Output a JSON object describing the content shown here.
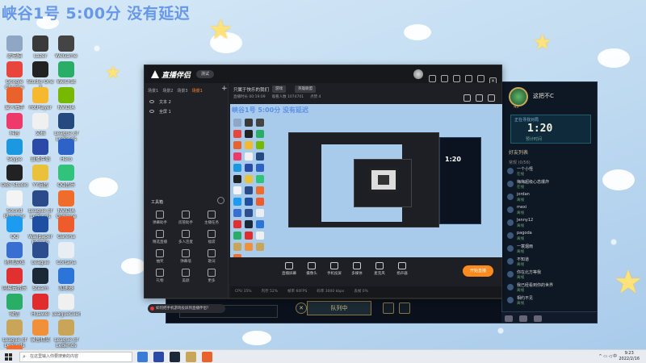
{
  "overlay": {
    "title": "峡谷1号 5:00分 没有延迟"
  },
  "desktop_icons": [
    {
      "label": "此电脑",
      "color": "#8fa6c4",
      "icon": "computer-icon"
    },
    {
      "label": "Lazer",
      "color": "#3a3a3a",
      "icon": "app-icon"
    },
    {
      "label": "WeGame",
      "color": "#444",
      "icon": "wegame-icon"
    },
    {
      "label": "Google Chrome",
      "color": "#e8453c",
      "icon": "chrome-icon"
    },
    {
      "label": "Studio One 3",
      "color": "#222",
      "icon": "studio-one-icon"
    },
    {
      "label": "WeChat",
      "color": "#2aae67",
      "icon": "wechat-icon"
    },
    {
      "label": "爱人抽手",
      "color": "#e9622c",
      "icon": "app-icon"
    },
    {
      "label": "PotPlayer",
      "color": "#f5b82e",
      "icon": "potplayer-icon"
    },
    {
      "label": "NVIDIA",
      "color": "#76b900",
      "icon": "app-icon"
    },
    {
      "label": "抖音",
      "color": "#ee3a6b",
      "icon": "app-icon"
    },
    {
      "label": "文档",
      "color": "#f0f0f0",
      "icon": "file-icon"
    },
    {
      "label": "League of Legends",
      "color": "#244a80",
      "icon": "lol-icon"
    },
    {
      "label": "Skype",
      "color": "#1b98e0",
      "icon": "skype-icon"
    },
    {
      "label": "直播伴侣",
      "color": "#2b4aa8",
      "icon": "app-icon"
    },
    {
      "label": "Hero",
      "color": "#2d63c7",
      "icon": "app-icon"
    },
    {
      "label": "OBS Studio",
      "color": "#222",
      "icon": "obs-icon"
    },
    {
      "label": "YY语音",
      "color": "#e9c13a",
      "icon": "app-icon"
    },
    {
      "label": "QQ音乐",
      "color": "#31c27c",
      "icon": "app-icon"
    },
    {
      "label": "Sound Manager",
      "color": "#f4f4f4",
      "icon": "file-icon"
    },
    {
      "label": "League of Legends",
      "color": "#2a4a8a",
      "icon": "lol-icon"
    },
    {
      "label": "NVIDIA GeForce",
      "color": "#ef6c2b",
      "icon": "app-icon"
    },
    {
      "label": "QQ",
      "color": "#1d9bf0",
      "icon": "qq-icon"
    },
    {
      "label": "Wallpaper Engine",
      "color": "#1f4fa0",
      "icon": "app-icon"
    },
    {
      "label": "Garena",
      "color": "#ee5c2c",
      "icon": "app-icon"
    },
    {
      "label": "腾讯游戏",
      "color": "#3a6fd2",
      "icon": "app-icon"
    },
    {
      "label": "League",
      "color": "#2c4d8e",
      "icon": "lol-icon"
    },
    {
      "label": "Cortana",
      "color": "#e8eef4",
      "icon": "app-icon"
    },
    {
      "label": "网易云音乐",
      "color": "#e03030",
      "icon": "netease-icon"
    },
    {
      "label": "Steam",
      "color": "#1b2838",
      "icon": "steam-icon"
    },
    {
      "label": "加速器",
      "color": "#2b74d8",
      "icon": "app-icon"
    },
    {
      "label": "微信",
      "color": "#2aae67",
      "icon": "wechat-icon"
    },
    {
      "label": "Huawei",
      "color": "#e02c2c",
      "icon": "app-icon"
    },
    {
      "label": "LeagueClient",
      "color": "#f0f0f0",
      "icon": "file-icon"
    },
    {
      "label": "League of Legends",
      "color": "#c9a55a",
      "icon": "lol-icon"
    },
    {
      "label": "录音精灵",
      "color": "#f0913a",
      "icon": "app-icon"
    },
    {
      "label": "League of Legends",
      "color": "#c9a55a",
      "icon": "lol-icon"
    },
    {
      "label": "Origin",
      "color": "#f56c2d",
      "icon": "origin-icon"
    }
  ],
  "app": {
    "logo": "直播伴侣",
    "version": "测试",
    "left_tabs": [
      "场景1",
      "场景2",
      "场景3",
      "场景1"
    ],
    "sources": [
      "文本 2",
      "全屏 1"
    ],
    "tools_title": "工具箱",
    "tools": [
      {
        "label": "弹幕助手"
      },
      {
        "label": "房管助手"
      },
      {
        "label": "主播任务"
      },
      {
        "label": "精选直播"
      },
      {
        "label": "多人连麦"
      },
      {
        "label": "福袋"
      },
      {
        "label": "抽奖"
      },
      {
        "label": "弹幕墙"
      },
      {
        "label": "歌词"
      },
      {
        "label": "礼物"
      },
      {
        "label": "美颜"
      },
      {
        "label": "更多"
      }
    ],
    "tip": "如何把手机游戏投屏到直播伴侣？",
    "room_title": "只属于快乐的我们",
    "tag1": "游戏",
    "tag2": "英雄联盟",
    "info": [
      "直播时长 00:19:09",
      "观看人数 1074701",
      "点赞 4"
    ],
    "preview_title": "峡谷1号 5:00分 没有延迟",
    "nested_time": "1:20",
    "bottom_tools": [
      {
        "label": "直播屏幕"
      },
      {
        "label": "摄像头"
      },
      {
        "label": "手机投屏"
      },
      {
        "label": "多媒体"
      },
      {
        "label": "麦克风"
      },
      {
        "label": "扬声器"
      }
    ],
    "start_label": "开始直播",
    "status": [
      "CPU 35%",
      "内存 52%",
      "帧率 60FPS",
      "码率 3000 kbps",
      "丢帧 0%"
    ]
  },
  "game": {
    "player_name": "这把不C",
    "player_level": "43",
    "scores": [
      "950",
      "0"
    ],
    "queue_title": "正在寻找对局",
    "queue_time": "1:20",
    "queue_sub": "预计时间",
    "friends_title": "好友列表",
    "group_title": "常规 (0/56)",
    "friends": [
      {
        "name": "一个小怪",
        "status": "在线"
      },
      {
        "name": "梅梅超级心态爆炸",
        "status": "在线"
      },
      {
        "name": "jordan",
        "status": "离线"
      },
      {
        "name": "mexi",
        "status": "离线"
      },
      {
        "name": "Jenny12",
        "status": "离线"
      },
      {
        "name": "pagoda",
        "status": "离线"
      },
      {
        "name": "一蓑烟雨",
        "status": "离线"
      },
      {
        "name": "不知道",
        "status": "离线"
      },
      {
        "name": "你在北方等我",
        "status": "离线"
      },
      {
        "name": "我已经看到你的世界",
        "status": "离线"
      },
      {
        "name": "相约不见",
        "status": "离线"
      }
    ],
    "queue_button": "队列中"
  },
  "taskbar": {
    "search_placeholder": "在这里输入你要搜索的内容",
    "time": "9:23",
    "date": "2022/2/16",
    "ime": "中",
    "apps": [
      {
        "color": "#3b7ad6",
        "icon": "task-view-icon"
      },
      {
        "color": "#2b4aa8",
        "icon": "app-icon"
      },
      {
        "color": "#1b2838",
        "icon": "app-icon"
      },
      {
        "color": "#c9a55a",
        "icon": "lol-icon"
      },
      {
        "color": "#e9622c",
        "icon": "app-icon"
      }
    ]
  }
}
